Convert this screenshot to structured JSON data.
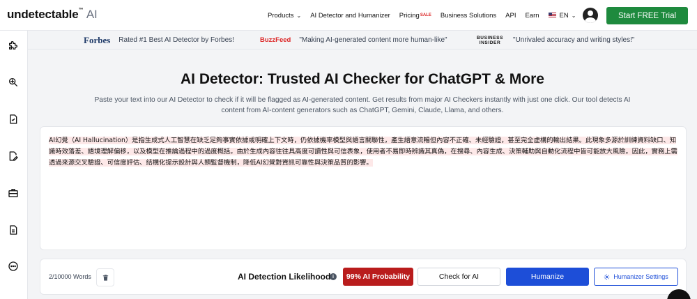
{
  "brand": {
    "name": "undetectable",
    "tm": "™",
    "suffix": "AI"
  },
  "nav": {
    "products": "Products",
    "detector": "AI Detector and Humanizer",
    "pricing": "Pricing",
    "sale": "SALE",
    "business": "Business Solutions",
    "api": "API",
    "earn": "Earn",
    "language": "EN",
    "cta": "Start FREE Trial"
  },
  "press": [
    {
      "logo": "Forbes",
      "quote": "Rated #1 Best AI Detector by Forbes!"
    },
    {
      "logo": "BuzzFeed",
      "quote": "\"Making AI-generated content more human-like\""
    },
    {
      "logo_line1": "BUSINESS",
      "logo_line2": "INSIDER",
      "quote": "\"Unrivaled accuracy and writing styles!\""
    }
  ],
  "sidebar": {
    "icons": [
      "puzzle-icon",
      "search-zoom-icon",
      "document-check-icon",
      "document-edit-icon",
      "briefcase-icon",
      "document-icon",
      "more-icon"
    ]
  },
  "page": {
    "title": "AI Detector: Trusted AI Checker for ChatGPT & More",
    "subtitle": "Paste your text into our AI Detector to check if it will be flagged as AI-generated content. Get results from major AI Checkers instantly with just one click. Our tool detects AI content from AI-content generators such as ChatGPT, Gemini, Claude, Llama, and others."
  },
  "editor": {
    "segments": [
      {
        "text": "AI幻覺（AI Hallucination）是指生成式人工智慧在缺乏足夠事實依據或明確上下文時，仍依據機率模型與語言關聯性，",
        "highlight": true
      },
      {
        "text": "產生語意流暢但內容不正確、未經驗證，甚至完全虛構的輸出結果。",
        "highlight": true
      },
      {
        "text": "此現象多源於訓練資料缺口、知識時效落差、語境理解偏移，以及模型在推論過程中的過度概括。",
        "highlight": true
      },
      {
        "text": "由於生成內容往往具高度可讀性與可信表象，使用者不易即時辨識其真偽，在搜尋、內容生成、決策輔助與自動化流程中皆可能放大風險。",
        "highlight": true
      },
      {
        "text": "因此，實務上需透過來源交叉驗證、可信度評估、結構化提示設計與人類監督機制，降低AI幻覺對資訊可靠性與決策品質的影響。",
        "highlight": true
      }
    ]
  },
  "toolbar": {
    "word_count": "2/10000 Words",
    "likelihood_label": "AI Detection Likelihood",
    "info": "i",
    "probability": "99% AI Probability",
    "check": "Check for AI",
    "humanize": "Humanize",
    "settings": "Humanizer Settings"
  },
  "colors": {
    "cta_green": "#1e8a3e",
    "primary_blue": "#1d4ed8",
    "danger_red": "#b91c1c",
    "highlight_pink": "#fde8e8"
  }
}
